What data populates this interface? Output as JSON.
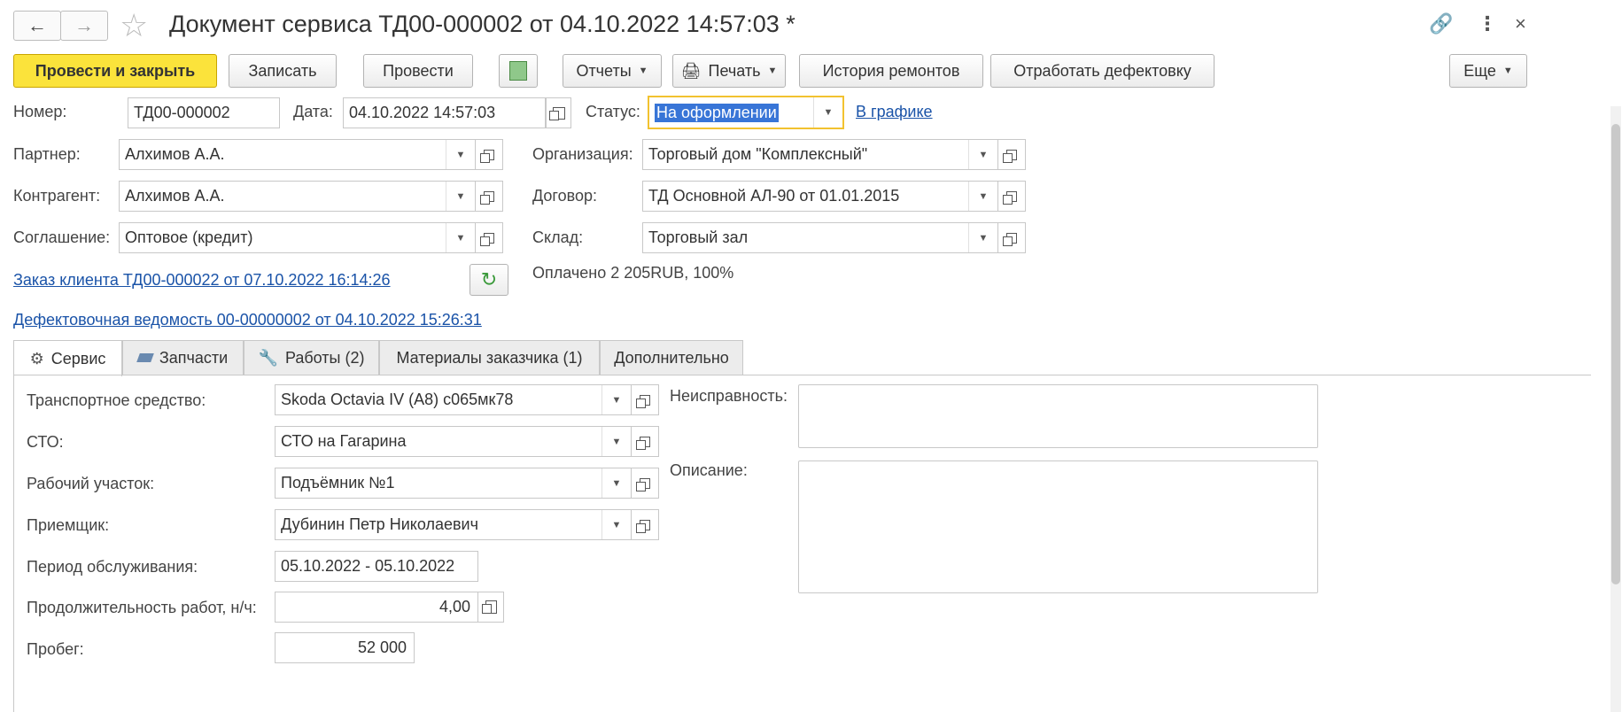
{
  "window": {
    "title": "Документ сервиса ТД00-000002 от 04.10.2022 14:57:03 *"
  },
  "toolbar": {
    "post_close": "Провести и закрыть",
    "save": "Записать",
    "post": "Провести",
    "reports": "Отчеты",
    "print": "Печать",
    "repair_history": "История ремонтов",
    "process_defects": "Отработать дефектовку",
    "more": "Еще"
  },
  "header": {
    "number_label": "Номер:",
    "number_value": "ТД00-000002",
    "date_label": "Дата:",
    "date_value": "04.10.2022 14:57:03",
    "status_label": "Статус:",
    "status_value": "На оформлении",
    "schedule_link": "В графике",
    "partner_label": "Партнер:",
    "partner_value": "Алхимов А.А.",
    "contractor_label": "Контрагент:",
    "contractor_value": "Алхимов А.А.",
    "agreement_label": "Соглашение:",
    "agreement_value": "Оптовое (кредит)",
    "organization_label": "Организация:",
    "organization_value": "Торговый дом \"Комплексный\"",
    "contract_label": "Договор:",
    "contract_value": "ТД Основной АЛ-90 от 01.01.2015",
    "warehouse_label": "Склад:",
    "warehouse_value": "Торговый зал",
    "client_order_link": "Заказ клиента ТД00-000022 от 07.10.2022 16:14:26",
    "paid_text": "Оплачено 2 205RUB, 100%",
    "defect_sheet_link": "Дефектовочная ведомость 00-00000002 от 04.10.2022 15:26:31"
  },
  "tabs": [
    {
      "label": "Сервис",
      "icon": "gear-icon"
    },
    {
      "label": "Запчасти",
      "icon": "parts-icon"
    },
    {
      "label": "Работы (2)",
      "icon": "wrench-icon"
    },
    {
      "label": "Материалы заказчика (1)",
      "icon": ""
    },
    {
      "label": "Дополнительно",
      "icon": ""
    }
  ],
  "service": {
    "vehicle_label": "Транспортное средство:",
    "vehicle_value": "Skoda Octavia IV (A8) с065мк78",
    "sto_label": "СТО:",
    "sto_value": "СТО на Гагарина",
    "workplace_label": "Рабочий участок:",
    "workplace_value": "Подъёмник №1",
    "receiver_label": "Приемщик:",
    "receiver_value": "Дубинин Петр Николаевич",
    "period_label": "Период обслуживания:",
    "period_value": "05.10.2022 - 05.10.2022",
    "duration_label": "Продолжительность работ, н/ч:",
    "duration_value": "4,00",
    "mileage_label": "Пробег:",
    "mileage_value": "52 000",
    "malfunction_label": "Неисправность:",
    "description_label": "Описание:"
  }
}
